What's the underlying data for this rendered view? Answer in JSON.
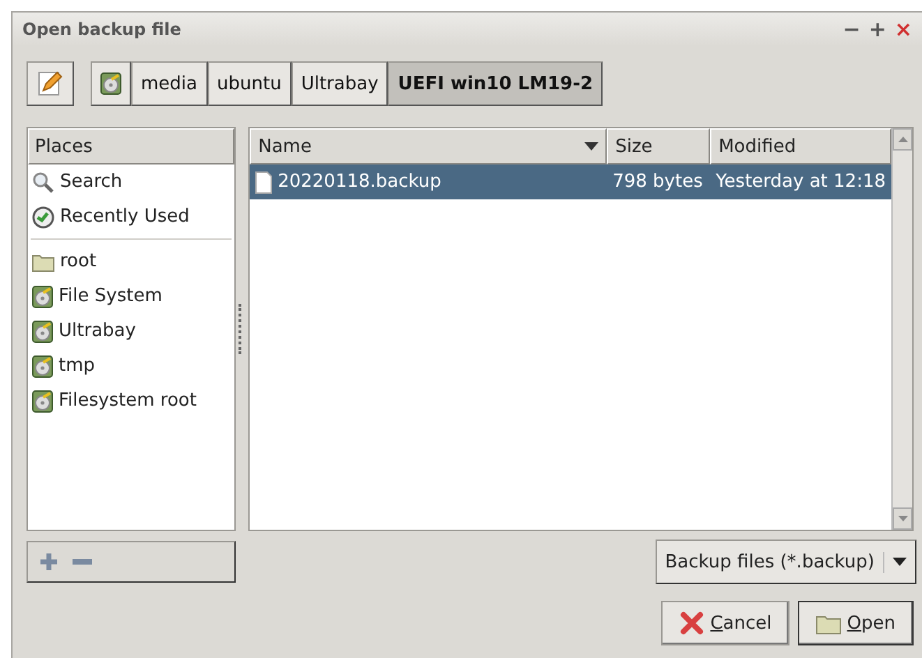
{
  "window": {
    "title": "Open backup file",
    "controls": [
      "−",
      "+",
      "×"
    ]
  },
  "path_bar": {
    "segments": [
      {
        "label": "media",
        "selected": false
      },
      {
        "label": "ubuntu",
        "selected": false
      },
      {
        "label": "Ultrabay",
        "selected": false
      },
      {
        "label": "UEFI win10 LM19-2",
        "selected": true
      }
    ]
  },
  "places": {
    "heading": "Places",
    "items": [
      {
        "kind": "search",
        "label": "Search"
      },
      {
        "kind": "recent",
        "label": "Recently Used"
      },
      {
        "kind": "separator"
      },
      {
        "kind": "folder",
        "label": "root"
      },
      {
        "kind": "drive",
        "label": "File System"
      },
      {
        "kind": "drive",
        "label": "Ultrabay"
      },
      {
        "kind": "drive",
        "label": "tmp"
      },
      {
        "kind": "drive",
        "label": "Filesystem root"
      }
    ]
  },
  "files": {
    "columns": [
      "Name",
      "Size",
      "Modified"
    ],
    "rows": [
      {
        "name": "20220118.backup",
        "size": "798 bytes",
        "modified": "Yesterday at 12:18",
        "selected": true
      }
    ]
  },
  "filter": {
    "value": "Backup files (*.backup)"
  },
  "buttons": [
    {
      "kind": "cancel",
      "label": "Cancel"
    },
    {
      "kind": "open",
      "label": "Open"
    }
  ]
}
